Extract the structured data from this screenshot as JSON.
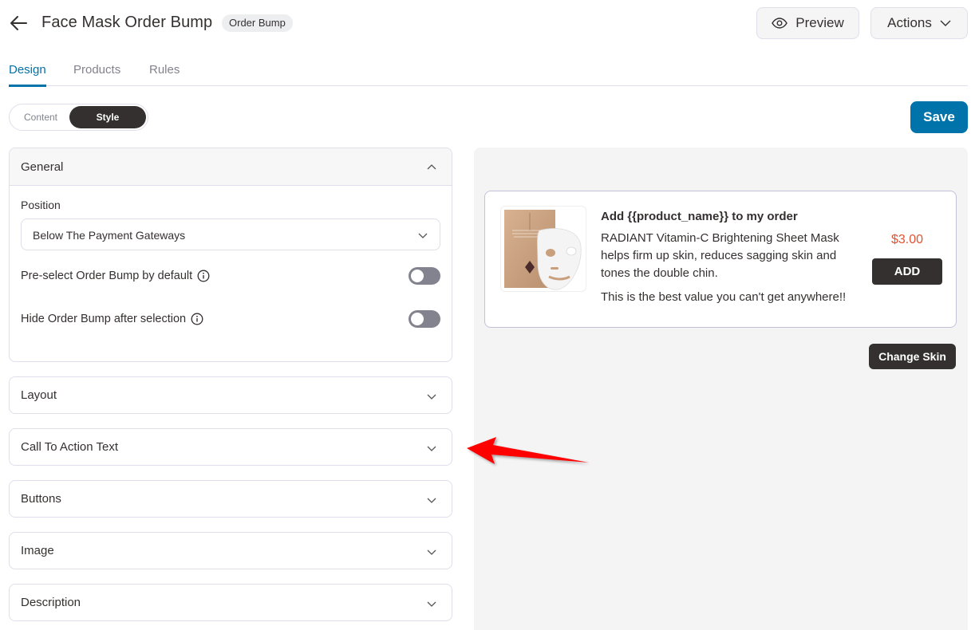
{
  "header": {
    "title": "Face Mask Order Bump",
    "badge": "Order Bump",
    "preview_label": "Preview",
    "actions_label": "Actions"
  },
  "tabs": [
    {
      "label": "Design",
      "active": true
    },
    {
      "label": "Products",
      "active": false
    },
    {
      "label": "Rules",
      "active": false
    }
  ],
  "mode_switch": {
    "options": [
      "Content",
      "Style"
    ],
    "selected": "Style"
  },
  "save_label": "Save",
  "general": {
    "title": "General",
    "expanded": true,
    "position_label": "Position",
    "position_value": "Below The Payment Gateways",
    "toggles": [
      {
        "label": "Pre-select Order Bump by default",
        "on": false
      },
      {
        "label": "Hide Order Bump after selection",
        "on": false
      }
    ]
  },
  "sections": [
    {
      "title": "Layout"
    },
    {
      "title": "Call To Action Text"
    },
    {
      "title": "Buttons"
    },
    {
      "title": "Image"
    },
    {
      "title": "Description"
    }
  ],
  "preview": {
    "title": "Add {{product_name}} to my order",
    "description": "RADIANT Vitamin-C Brightening Sheet Mask helps firm up skin, reduces sagging skin and tones the double chin.",
    "extra": "This is the best value you can't get anywhere!!",
    "price": "$3.00",
    "add_label": "ADD",
    "change_skin_label": "Change Skin",
    "image_alt": "face-mask-product-image"
  },
  "colors": {
    "primary": "#0073aa",
    "dark": "#353030",
    "price": "#e15334",
    "annotation_arrow": "#ff0000"
  }
}
